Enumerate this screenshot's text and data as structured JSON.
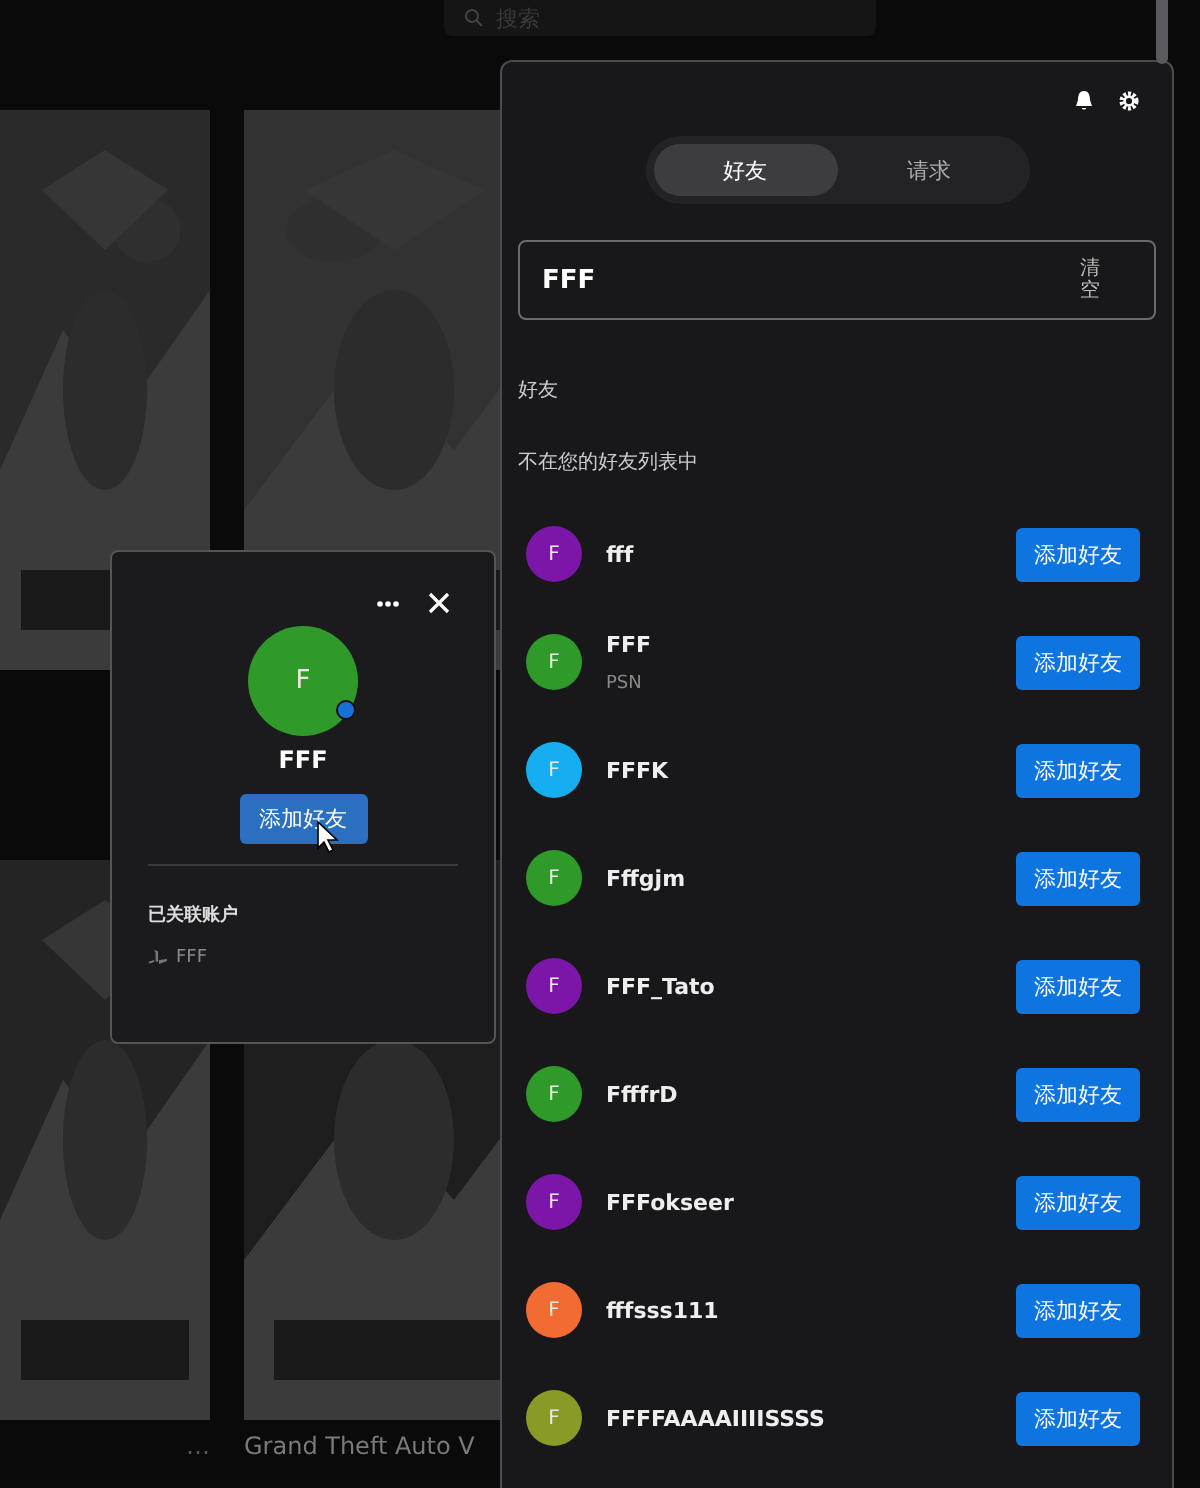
{
  "top_bar": {
    "search": {
      "placeholder": "搜索"
    }
  },
  "library": {
    "more_label": "…",
    "game_title": "Grand Theft Auto V"
  },
  "friends_panel": {
    "tabs": [
      {
        "label": "好友",
        "selected": true
      },
      {
        "label": "请求",
        "selected": false
      }
    ],
    "search": {
      "value": "FFF",
      "clear_label": "清空"
    },
    "section_title": "好友",
    "subheading": "不在您的好友列表中",
    "results": [
      {
        "initial": "F",
        "name": "fff",
        "color": "#7b16a8",
        "action": "添加好友"
      },
      {
        "initial": "F",
        "name": "FFF",
        "platform": "PSN",
        "color": "#2f9a2a",
        "action": "添加好友"
      },
      {
        "initial": "F",
        "name": "FFFK",
        "color": "#16aef0",
        "action": "添加好友"
      },
      {
        "initial": "F",
        "name": "Fffgjm",
        "color": "#2f9a2a",
        "action": "添加好友"
      },
      {
        "initial": "F",
        "name": "FFF_Tato",
        "color": "#7b16a8",
        "action": "添加好友"
      },
      {
        "initial": "F",
        "name": "FfffrD",
        "color": "#2f9a2a",
        "action": "添加好友"
      },
      {
        "initial": "F",
        "name": "FFFokseer",
        "color": "#7b16a8",
        "action": "添加好友"
      },
      {
        "initial": "F",
        "name": "fffsss111",
        "color": "#f26b32",
        "action": "添加好友"
      },
      {
        "initial": "F",
        "name": "FFFFAAAAIIIISSSS",
        "color": "#8a9a26",
        "action": "添加好友"
      }
    ]
  },
  "profile_popup": {
    "initial": "F",
    "color": "#2f9a2a",
    "online": true,
    "name": "FFF",
    "action": "添加好友",
    "linked_title": "已关联账户",
    "linked_accounts": [
      {
        "name": "FFF"
      }
    ]
  }
}
